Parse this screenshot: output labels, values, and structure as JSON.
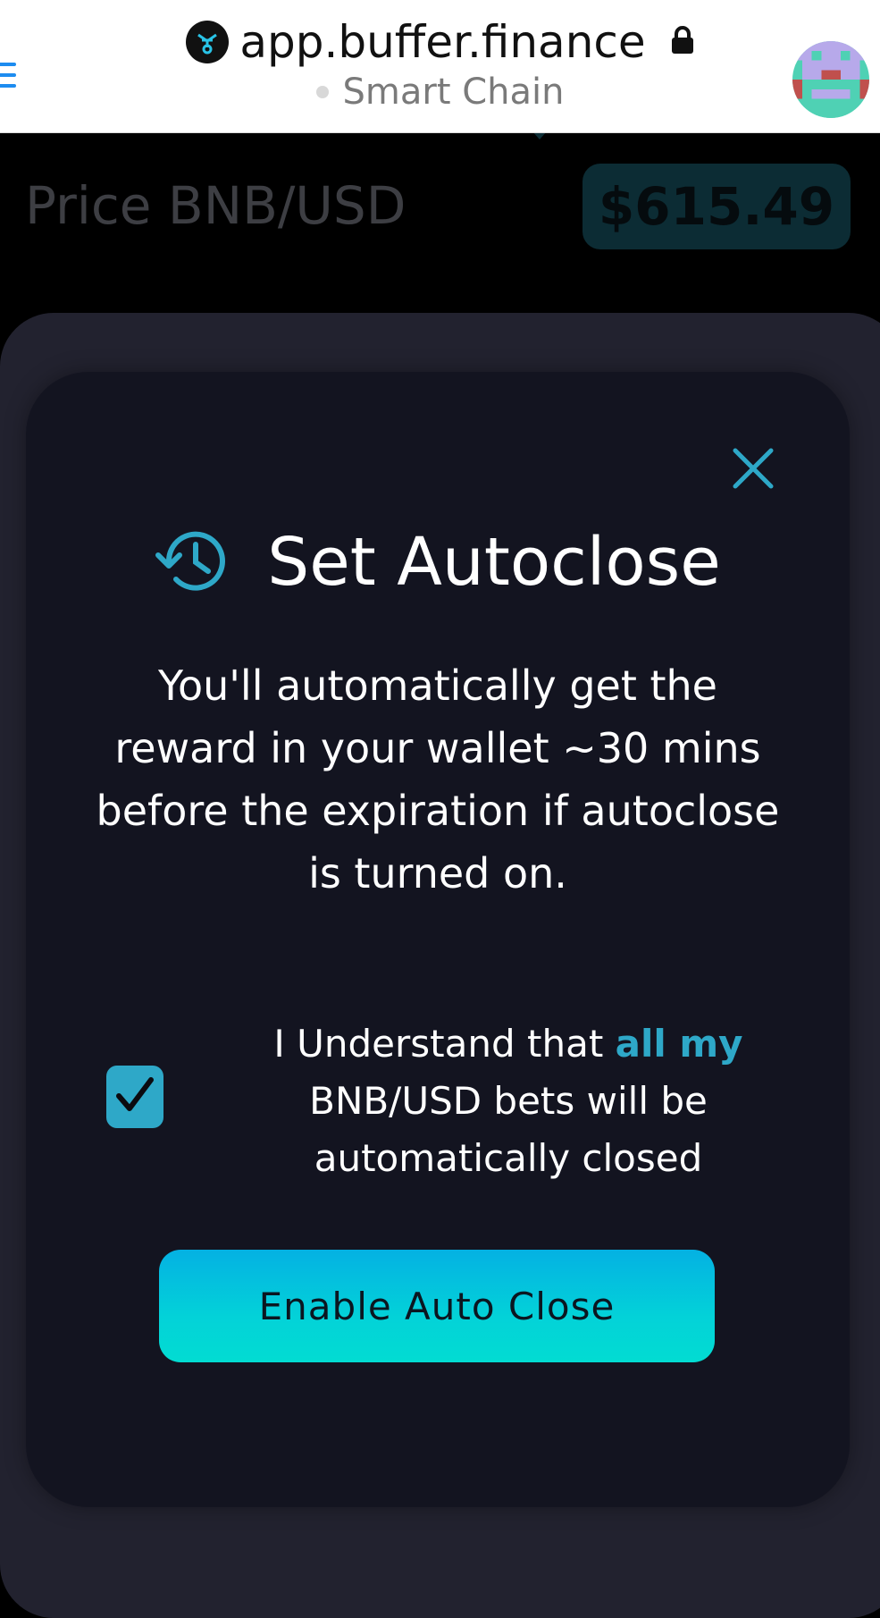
{
  "browser": {
    "url": "app.buffer.finance",
    "network": "Smart Chain"
  },
  "page": {
    "price_label": "Price BNB/USD",
    "price_value": "$615.49"
  },
  "modal": {
    "title": "Set Autoclose",
    "description": "You'll automatically get the reward in your wallet ~30 mins before the expiration if autoclose is turned on.",
    "consent_prefix": "I Understand that ",
    "consent_highlight": "all my",
    "consent_suffix": " BNB/USD bets will be automatically closed",
    "consent_checked": true,
    "button_label": "Enable Auto Close"
  },
  "colors": {
    "accent": "#2ea8c8",
    "modal_bg": "#131420",
    "sheet_bg": "#22222f",
    "button_gradient": [
      "#04b1e3",
      "#02dcd2"
    ]
  }
}
